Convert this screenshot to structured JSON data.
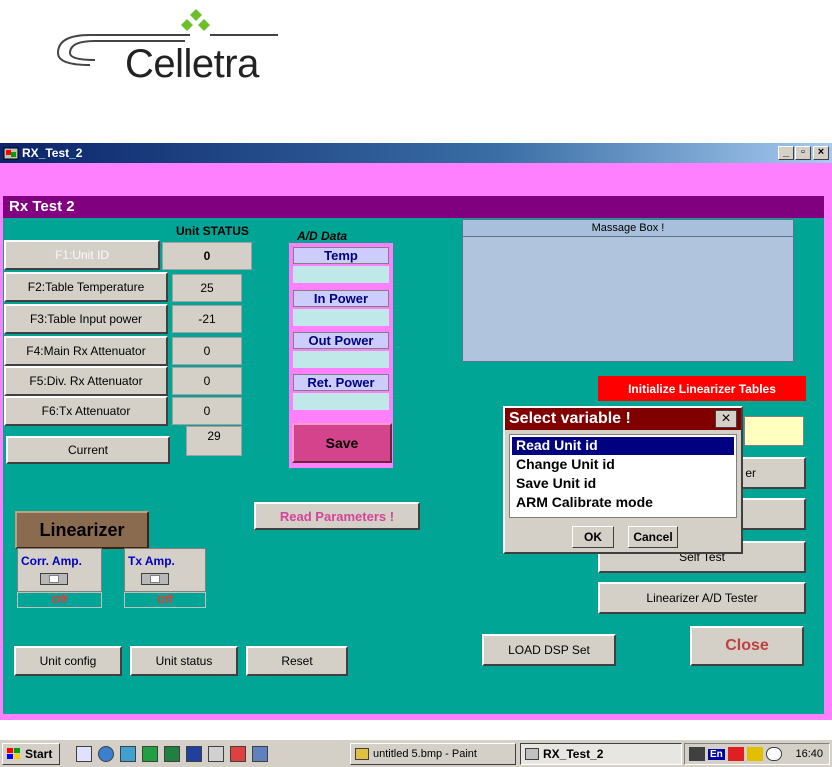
{
  "logo": {
    "text": "Celletra"
  },
  "window": {
    "title": "RX_Test_2",
    "min": "_",
    "max": "▫",
    "close": "×"
  },
  "panel": {
    "title": "Rx Test 2"
  },
  "unit_status": {
    "header": "Unit STATUS",
    "rows": [
      {
        "label": "F1:Unit ID",
        "value": "0"
      },
      {
        "label": "F2:Table Temperature",
        "value": "25"
      },
      {
        "label": "F3:Table Input power",
        "value": "-21"
      },
      {
        "label": "F4:Main Rx Attenuator",
        "value": "0"
      },
      {
        "label": "F5:Div. Rx Attenuator",
        "value": "0"
      },
      {
        "label": "F6:Tx Attenuator",
        "value": "0"
      },
      {
        "label": "Current",
        "value": "29"
      }
    ]
  },
  "ad_data": {
    "header": "A/D Data",
    "labels": [
      "Temp",
      "In Power",
      "Out Power",
      "Ret. Power"
    ],
    "save": "Save"
  },
  "massage_box": {
    "title": "Massage Box !"
  },
  "buttons": {
    "init_linearizer": "Initialize Linearizer Tables",
    "read_params": "Read  Parameters !",
    "btn_er_partial": "er",
    "self_test": "Self Test",
    "lin_ad_tester": "Linearizer A/D  Tester",
    "load_dsp": "LOAD DSP Set",
    "close": "Close",
    "unit_config": "Unit config",
    "unit_status": "Unit status",
    "reset": "Reset"
  },
  "linearizer": {
    "title": "Linearizer",
    "corr_amp": {
      "label": "Corr. Amp.",
      "state": "Off"
    },
    "tx_amp": {
      "label": "Tx  Amp.",
      "state": "Off"
    }
  },
  "dialog": {
    "title": "Select variable !",
    "close": "×",
    "options": [
      "Read Unit id",
      "Change Unit id",
      "Save Unit id",
      "ARM Calibrate mode"
    ],
    "selected_index": 0,
    "ok": "OK",
    "cancel": "Cancel"
  },
  "taskbar": {
    "start": "Start",
    "tasks": [
      {
        "label": "untitled 5.bmp - Paint",
        "active": false
      },
      {
        "label": "RX_Test_2",
        "active": true
      }
    ],
    "tray_lang": "En",
    "clock": "16:40"
  },
  "colors": {
    "panel_teal": "#00a595",
    "frame_pink": "#ff80ff",
    "header_purple": "#800080",
    "dialog_title": "#800000",
    "alert_red": "#ff0000"
  }
}
